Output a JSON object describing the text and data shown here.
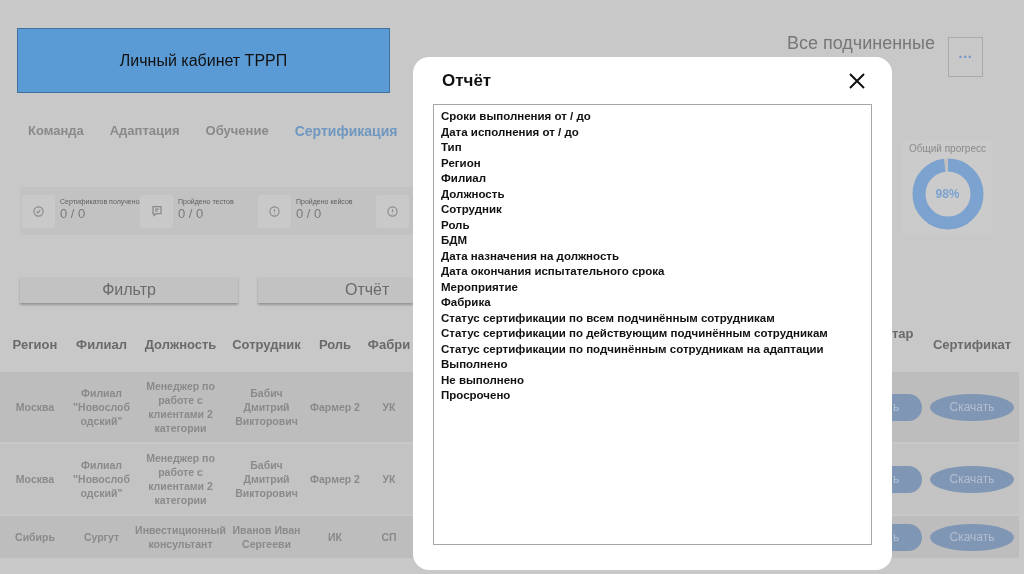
{
  "header": {
    "title": "Личный кабинет ТРРП",
    "scope": "Все подчиненные",
    "more_button": "···"
  },
  "tabs": [
    {
      "label": "Команда",
      "selected": false
    },
    {
      "label": "Адаптация",
      "selected": false
    },
    {
      "label": "Обучение",
      "selected": false
    },
    {
      "label": "Сертификация",
      "selected": true
    }
  ],
  "stats": [
    {
      "kind": "check",
      "label": "Сертификатов получено",
      "value": "0 / 0"
    },
    {
      "kind": "note",
      "label": "Пройдено тестов",
      "value": "0 / 0"
    },
    {
      "kind": "alert",
      "label": "Пройдено кейсов",
      "value": "0 / 0"
    },
    {
      "kind": "alert"
    }
  ],
  "progress": {
    "label": "Общий прогресс",
    "value": "98%",
    "level": 0.98
  },
  "actions": [
    {
      "label": "Фильтр"
    },
    {
      "label": "Отчёт"
    }
  ],
  "table": {
    "columns": [
      "Регион",
      "Филиал",
      "Должность",
      "Сотрудник",
      "Роль",
      "Фабри",
      "тар",
      "Сертификат"
    ],
    "rows": [
      {
        "cells": [
          "Москва",
          "Филиал \"Новослободский\"",
          "Менеджер по работе с клиентами 2 категории",
          "Бабич Дмитрий Викторович",
          "Фармер 2",
          "УК"
        ],
        "buttons": [
          "ь",
          "Скачать"
        ]
      },
      {
        "cells": [
          "Москва",
          "Филиал \"Новослободский\"",
          "Менеджер по работе с клиентами 2 категории",
          "Бабич Дмитрий Викторович",
          "Фармер 2",
          "УК"
        ],
        "buttons": [
          "ь",
          "Скачать"
        ]
      },
      {
        "cells": [
          "Сибирь",
          "Сургут",
          "Инвестиционный консультант",
          "Иванов Иван Сергееви",
          "ИК",
          "СП"
        ],
        "buttons": [
          "ь",
          "Скачать"
        ]
      }
    ]
  },
  "modal": {
    "title": "Отчёт",
    "items": [
      "Сроки выполнения от / до",
      "Дата исполнения от / до",
      "Тип",
      "Регион",
      "Филиал",
      "Должность",
      "Сотрудник",
      "Роль",
      "БДМ",
      "Дата назначения на должность",
      "Дата окончания испытательного срока",
      "Мероприятие",
      "Фабрика",
      "Статус сертификации по всем подчинённым сотрудникам",
      "Статус сертификации по действующим подчинённым сотрудникам",
      "Статус сертификации по подчинённым сотрудникам на адаптации",
      "Выполнено",
      "Не выполнено",
      "Просрочено"
    ]
  }
}
